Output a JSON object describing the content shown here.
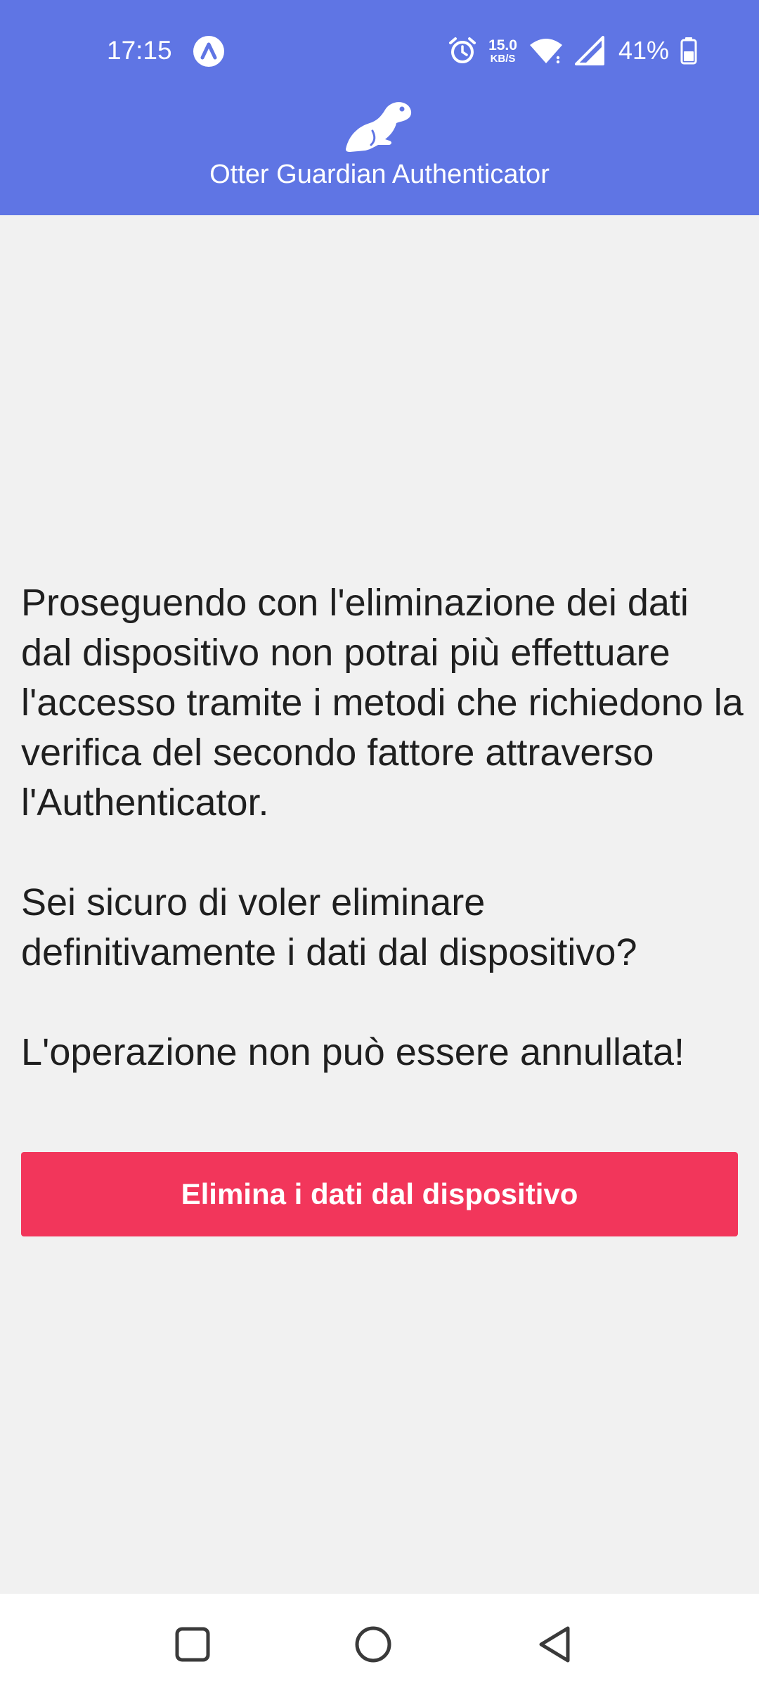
{
  "status_bar": {
    "time": "17:15",
    "net_speed_value": "15.0",
    "net_speed_unit": "KB/S",
    "battery_percent": "41%",
    "icons": [
      "app-notification-icon",
      "alarm-icon",
      "wifi-icon",
      "cellular-signal-icon",
      "battery-icon"
    ]
  },
  "app_bar": {
    "title": "Otter Guardian Authenticator",
    "logo": "otter-logo"
  },
  "main": {
    "paragraphs": [
      "Proseguendo con l'eliminazione dei dati dal dispositivo non potrai più effettuare l'accesso tramite i metodi che richiedono la verifica del secondo fattore attraverso l'Authenticator.",
      "Sei sicuro di voler eliminare definitivamente i dati dal dispositivo?",
      "L'operazione non può essere annullata!"
    ],
    "delete_button_label": "Elimina i dati dal dispositivo"
  },
  "colors": {
    "header_bg": "#5f75e4",
    "page_bg": "#f1f1f1",
    "danger_button": "#f2365b",
    "text": "#1f1f1f"
  },
  "nav_bar": {
    "buttons": [
      "recent-apps-icon",
      "home-icon",
      "back-icon"
    ]
  }
}
